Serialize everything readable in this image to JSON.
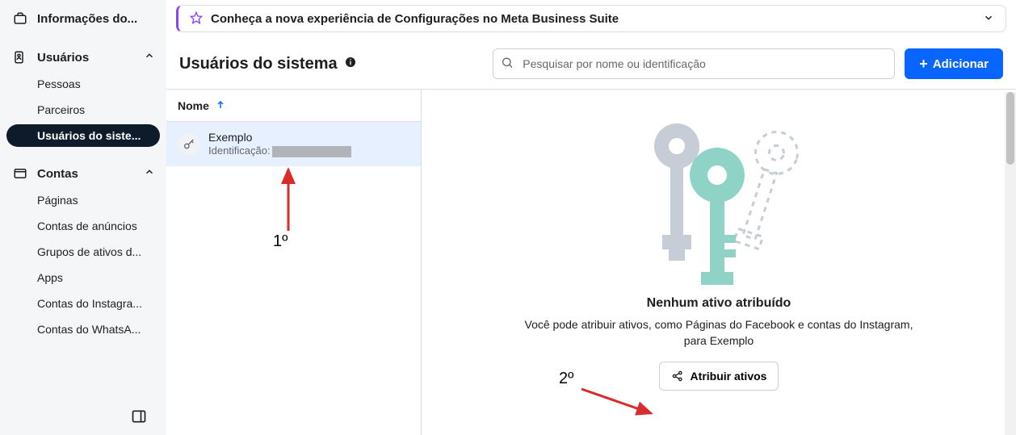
{
  "sidebar": {
    "top_item": "Informações do...",
    "sections": [
      {
        "label": "Usuários",
        "items": [
          "Pessoas",
          "Parceiros",
          "Usuários do siste..."
        ],
        "active_index": 2
      },
      {
        "label": "Contas",
        "items": [
          "Páginas",
          "Contas de anúncios",
          "Grupos de ativos d...",
          "Apps",
          "Contas do Instagra...",
          "Contas do WhatsA..."
        ],
        "active_index": -1
      }
    ]
  },
  "banner": {
    "text": "Conheça a nova experiência de Configurações no Meta Business Suite"
  },
  "header": {
    "title": "Usuários do sistema",
    "search_placeholder": "Pesquisar por nome ou identificação",
    "add_label": "Adicionar"
  },
  "list": {
    "header": "Nome",
    "items": [
      {
        "name": "Exemplo",
        "id_label": "Identificação:",
        "id_value": ""
      }
    ]
  },
  "detail": {
    "empty_title": "Nenhum ativo atribuído",
    "empty_body_1": "Você pode atribuir ativos, como Páginas do Facebook e contas do Instagram,",
    "empty_body_2": "para Exemplo",
    "assign_label": "Atribuir ativos"
  },
  "annotations": {
    "label1": "1º",
    "label2": "2º"
  }
}
